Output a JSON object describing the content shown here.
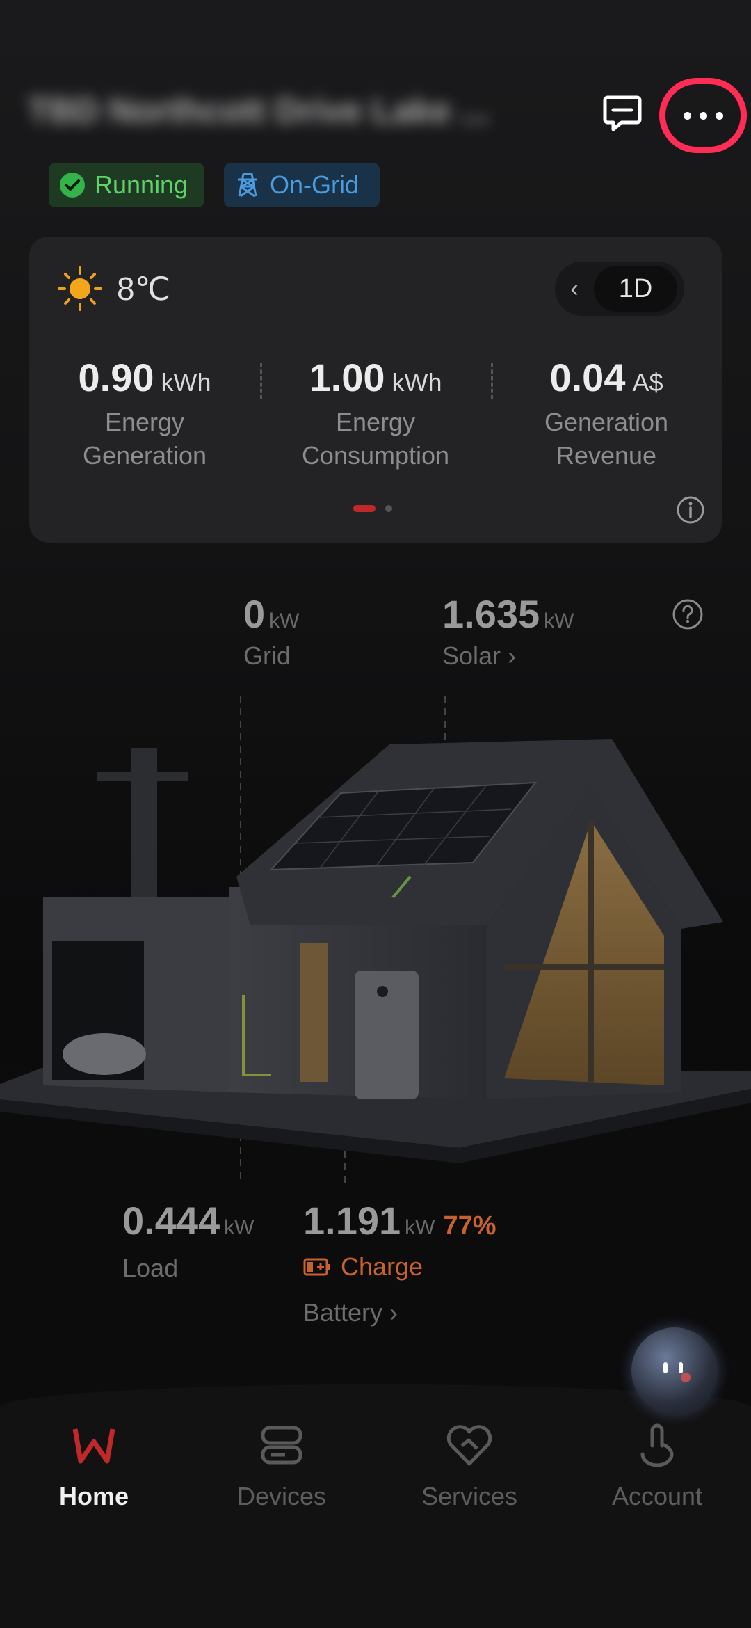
{
  "header": {
    "site_name": "TBD Northcott Drive Lake ...",
    "message_icon": "message-icon",
    "more_icon": "more-dots-icon"
  },
  "status": {
    "running_label": "Running",
    "grid_label": "On-Grid",
    "colors": {
      "running": "#5fd26a",
      "grid": "#4b9be0",
      "highlight": "#ff2d55"
    }
  },
  "stats_card": {
    "temperature": "8℃",
    "weather_icon": "sun-icon",
    "period": "1D",
    "items": [
      {
        "value": "0.90",
        "unit": "kWh",
        "label_line1": "Energy",
        "label_line2": "Generation"
      },
      {
        "value": "1.00",
        "unit": "kWh",
        "label_line1": "Energy",
        "label_line2": "Consumption"
      },
      {
        "value": "0.04",
        "unit": "A$",
        "label_line1": "Generation",
        "label_line2": "Revenue"
      }
    ]
  },
  "flow": {
    "grid": {
      "value": "0",
      "unit": "kW",
      "label": "Grid"
    },
    "solar": {
      "value": "1.635",
      "unit": "kW",
      "label": "Solar ›"
    },
    "load": {
      "value": "0.444",
      "unit": "kW",
      "label": "Load"
    },
    "battery": {
      "value": "1.191",
      "unit": "kW",
      "soc": "77%",
      "state": "Charge",
      "label": "Battery ›"
    },
    "colors": {
      "charge": "#c8622c"
    }
  },
  "nav": {
    "items": [
      {
        "label": "Home",
        "icon": "home-icon",
        "active": true
      },
      {
        "label": "Devices",
        "icon": "devices-icon"
      },
      {
        "label": "Services",
        "icon": "services-icon"
      },
      {
        "label": "Account",
        "icon": "account-icon"
      }
    ],
    "accent": "#c0282a"
  }
}
